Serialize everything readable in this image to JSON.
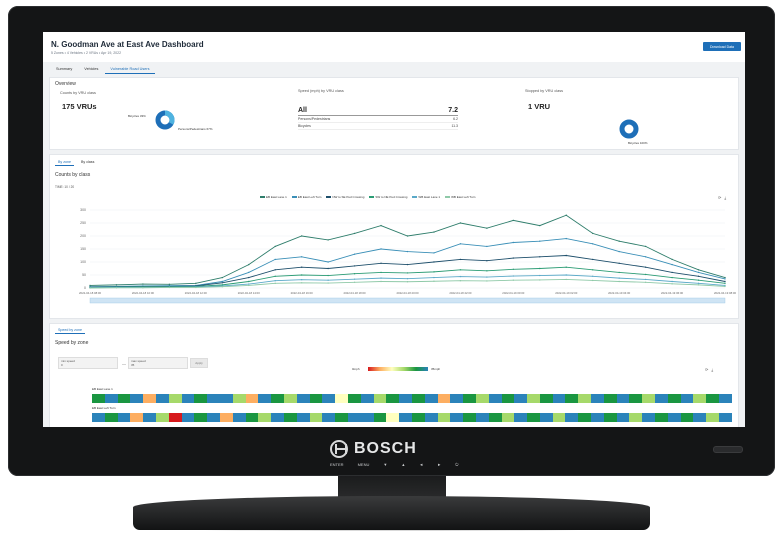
{
  "device": {
    "brand": "BOSCH",
    "controls": [
      "ENTER",
      "MENU",
      "▼",
      "▲",
      "◄",
      "►",
      "⏻"
    ]
  },
  "header": {
    "title": "N. Goodman Ave at East Ave Dashboard",
    "subtitle": "5 Zones • 4 Vehicles • 2 VRUs • Apr 19, 2022",
    "download_label": "Download Data"
  },
  "tabs": [
    {
      "label": "Summary"
    },
    {
      "label": "Vehicles"
    },
    {
      "label": "Vulnerable Road Users"
    }
  ],
  "overview": {
    "title": "Overview",
    "counts_label": "Counts by VRU class",
    "counts_value": "175 VRUs",
    "donut1_left": "Bicycles 33%",
    "donut1_right": "Persons/Pedestrians 67%",
    "speed_label": "Speed (mph) by VRU class",
    "speed_rows": [
      {
        "name": "All",
        "value": "7.2"
      },
      {
        "name": "Persons/Pedestrians",
        "value": "6.2"
      },
      {
        "name": "Bicycles",
        "value": "11.3"
      }
    ],
    "stopped_label": "Stopped by VRU class",
    "stopped_value": "1 VRU",
    "donut2_label": "Bicycles 100%"
  },
  "chart_section": {
    "subtabs": [
      "By zone",
      "By class"
    ],
    "title": "Counts by class",
    "subtitle": "TIME: 10 / 20",
    "tools": [
      "⟳",
      "⤓"
    ]
  },
  "chart_data": {
    "type": "line",
    "title": "Counts by class",
    "ylim": [
      0,
      300
    ],
    "yticks": [
      0,
      50,
      100,
      150,
      200,
      250,
      300
    ],
    "xticks": [
      "2022-04-18 08:00",
      "2022-04-18 09:00",
      "2022-04-18 10:00",
      "2022-04-18 11:00",
      "2022-04-18 12:00",
      "2022-04-18 13:00",
      "2022-04-18 14:00",
      "2022-04-18 15:00",
      "2022-04-18 16:00",
      "2022-04-18 17:00",
      "2022-04-18 18:00",
      "2022-04-18 19:00",
      "2022-04-18 20:00",
      "2022-04-18 21:00",
      "2022-04-18 22:00",
      "2022-04-18 23:00",
      "2022-04-19 00:00",
      "2022-04-19 01:00",
      "2022-04-19 02:00",
      "2022-04-19 03:00",
      "2022-04-19 04:00",
      "2022-04-19 05:00",
      "2022-04-19 06:00",
      "2022-04-19 07:00",
      "2022-04-19 08:00"
    ],
    "legend_position": "top",
    "series": [
      {
        "name": "EB East Lane 1",
        "color": "#2e7d6b",
        "values": [
          10,
          12,
          15,
          14,
          18,
          40,
          90,
          160,
          200,
          185,
          210,
          240,
          200,
          215,
          250,
          230,
          260,
          240,
          280,
          210,
          180,
          160,
          110,
          70,
          40
        ]
      },
      {
        "name": "EB East Left Turn",
        "color": "#3a8fb7",
        "values": [
          5,
          6,
          8,
          9,
          10,
          25,
          60,
          110,
          120,
          100,
          130,
          150,
          140,
          135,
          170,
          160,
          175,
          180,
          190,
          170,
          140,
          120,
          90,
          60,
          35
        ]
      },
      {
        "name": "NW to SE Ped Crossing",
        "color": "#1e4f6b",
        "values": [
          3,
          4,
          5,
          6,
          8,
          20,
          40,
          70,
          80,
          75,
          85,
          95,
          90,
          100,
          110,
          105,
          115,
          120,
          125,
          110,
          95,
          80,
          60,
          45,
          25
        ]
      },
      {
        "name": "SW to NE Ped Crossing",
        "color": "#2b9c74",
        "values": [
          2,
          3,
          4,
          5,
          6,
          12,
          25,
          45,
          50,
          48,
          55,
          60,
          58,
          62,
          70,
          66,
          72,
          75,
          80,
          70,
          60,
          52,
          40,
          30,
          18
        ]
      },
      {
        "name": "WB East Lane 1",
        "color": "#5aa9c8",
        "values": [
          1,
          2,
          2,
          3,
          4,
          8,
          15,
          28,
          32,
          30,
          34,
          38,
          36,
          40,
          44,
          42,
          46,
          48,
          50,
          45,
          38,
          33,
          25,
          18,
          10
        ]
      },
      {
        "name": "WB East Left Turn",
        "color": "#8fc9a8",
        "values": [
          0,
          1,
          1,
          2,
          2,
          5,
          10,
          18,
          20,
          19,
          22,
          25,
          24,
          26,
          28,
          27,
          30,
          31,
          33,
          29,
          25,
          22,
          16,
          12,
          6
        ]
      }
    ]
  },
  "heat_section": {
    "tab": "Speed by zone",
    "title": "Speed by zone",
    "min_label": "min speed",
    "min_value": "0",
    "max_label": "max speed",
    "max_value": "35",
    "apply_label": "Apply",
    "scale_min": "0mph",
    "scale_max": "35mph",
    "rows": [
      {
        "name": "EB East Lane 1",
        "cells": [
          "#1a9641",
          "#2b83ba",
          "#1a9641",
          "#2b83ba",
          "#fdae61",
          "#2b83ba",
          "#a6d96a",
          "#2b83ba",
          "#1a9641",
          "#2b83ba",
          "#2b83ba",
          "#a6d96a",
          "#fdae61",
          "#2b83ba",
          "#1a9641",
          "#a6d96a",
          "#2b83ba",
          "#1a9641",
          "#2b83ba",
          "#ffffbf",
          "#1a9641",
          "#2b83ba",
          "#a6d96a",
          "#1a9641",
          "#2b83ba",
          "#1a9641",
          "#2b83ba",
          "#fdae61",
          "#2b83ba",
          "#1a9641",
          "#a6d96a",
          "#2b83ba",
          "#1a9641",
          "#2b83ba",
          "#a6d96a",
          "#1a9641",
          "#2b83ba",
          "#1a9641",
          "#a6d96a",
          "#2b83ba",
          "#1a9641",
          "#2b83ba",
          "#1a9641",
          "#a6d96a",
          "#2b83ba",
          "#1a9641",
          "#2b83ba",
          "#a6d96a",
          "#1a9641",
          "#2b83ba"
        ]
      },
      {
        "name": "EB East Left Turn",
        "cells": [
          "#2b83ba",
          "#1a9641",
          "#2b83ba",
          "#fdae61",
          "#2b83ba",
          "#a6d96a",
          "#d7191c",
          "#2b83ba",
          "#1a9641",
          "#2b83ba",
          "#fdae61",
          "#2b83ba",
          "#1a9641",
          "#a6d96a",
          "#2b83ba",
          "#1a9641",
          "#2b83ba",
          "#a6d96a",
          "#2b83ba",
          "#1a9641",
          "#2b83ba",
          "#2b83ba",
          "#1a9641",
          "#ffffbf",
          "#2b83ba",
          "#1a9641",
          "#2b83ba",
          "#a6d96a",
          "#2b83ba",
          "#1a9641",
          "#2b83ba",
          "#1a9641",
          "#a6d96a",
          "#2b83ba",
          "#1a9641",
          "#2b83ba",
          "#a6d96a",
          "#2b83ba",
          "#1a9641",
          "#2b83ba",
          "#1a9641",
          "#2b83ba",
          "#a6d96a",
          "#2b83ba",
          "#1a9641",
          "#2b83ba",
          "#1a9641",
          "#2b83ba",
          "#a6d96a",
          "#2b83ba"
        ]
      }
    ]
  }
}
